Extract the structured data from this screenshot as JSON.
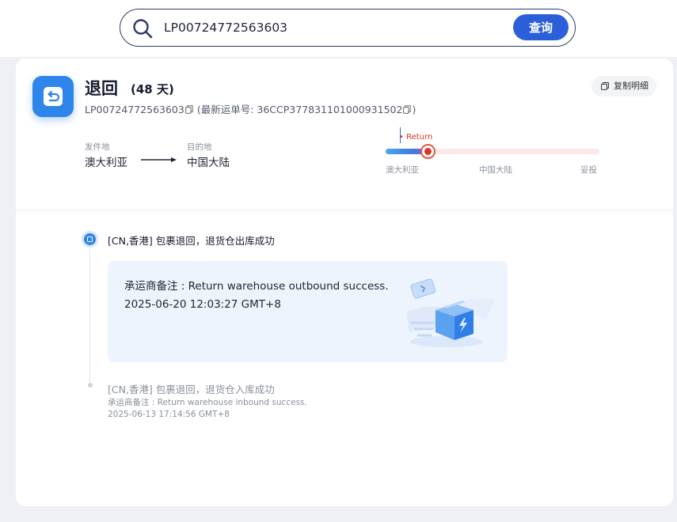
{
  "search": {
    "value": "LP00724772563603",
    "button_label": "查询",
    "icon": "search-icon"
  },
  "shipment": {
    "status_title": "退回",
    "days_label": "(48 天)",
    "tracking_number": "LP00724772563603",
    "latest_label": "(最新运单号: 36CCP377831101000931502",
    "latest_close": ")",
    "copy_details_label": "复制明细",
    "status_icon": "return-icon"
  },
  "route": {
    "origin_label": "发件地",
    "origin_value": "澳大利亚",
    "destination_label": "目的地",
    "destination_value": "中国大陆"
  },
  "progress": {
    "return_tag": "Return",
    "stops": [
      "澳大利亚",
      "中国大陆",
      "妥投"
    ],
    "fill_fraction": 0.2,
    "colors": {
      "return": "#d9342b",
      "fill": "#3f7de0"
    }
  },
  "events": [
    {
      "title": "[CN,香港] 包裹退回，退货仓出库成功",
      "note": "承运商备注 : Return warehouse outbound success.",
      "time": "2025-06-20 12:03:27 GMT+8"
    },
    {
      "title": "[CN,香港] 包裹退回，退货仓入库成功",
      "note": "承运商备注 : Return warehouse inbound success.",
      "time": "2025-06-13 17:14:56 GMT+8"
    }
  ],
  "colors": {
    "accent": "#2b5fd9",
    "status_blue": "#2f86ea",
    "event_card_bg": "#eef4fd"
  }
}
